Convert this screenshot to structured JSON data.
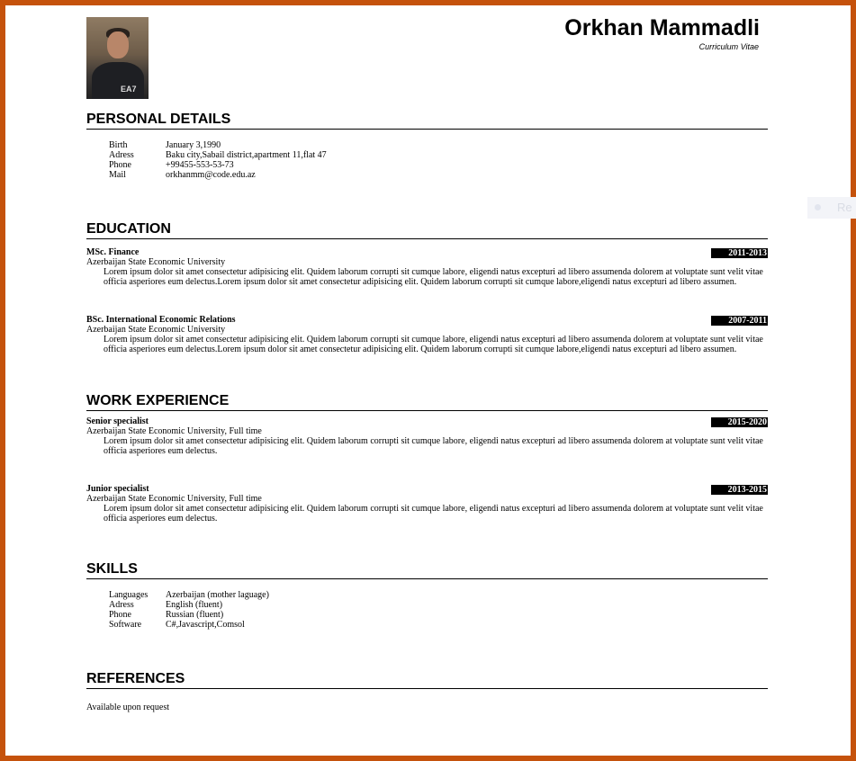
{
  "header": {
    "name": "Orkhan Mammadli",
    "subtitle": "Curriculum Vitae",
    "photo_alt": "profile-photo",
    "photo_logo": "EA7"
  },
  "personal": {
    "title": "PERSONAL DETAILS",
    "rows": [
      {
        "k": "Birth",
        "v": "January 3,1990"
      },
      {
        "k": "Adress",
        "v": "Baku city,Sabail district,apartment 11,flat 47"
      },
      {
        "k": "Phone",
        "v": "+99455-553-53-73"
      },
      {
        "k": "Mail",
        "v": "orkhanmm@code.edu.az"
      }
    ]
  },
  "education": {
    "title": "EDUCATION",
    "entries": [
      {
        "degree": "MSc. Finance",
        "date": "2011-2013",
        "org": "Azerbaijan State Economic University",
        "desc": "Lorem ipsum dolor sit amet consectetur adipisicing elit. Quidem laborum corrupti sit cumque labore, eligendi natus excepturi ad libero assumenda dolorem at voluptate sunt velit vitae officia asperiores eum delectus.Lorem ipsum dolor sit amet consectetur adipisicing elit. Quidem laborum corrupti sit cumque labore,eligendi natus excepturi ad libero assumen."
      },
      {
        "degree": "BSc. International Economic Relations",
        "date": "2007-2011",
        "org": "Azerbaijan State Economic University",
        "desc": "Lorem ipsum dolor sit amet consectetur adipisicing elit. Quidem laborum corrupti sit cumque labore, eligendi natus excepturi ad libero assumenda dolorem at voluptate sunt velit vitae officia asperiores eum delectus.Lorem ipsum dolor sit amet consectetur adipisicing elit. Quidem laborum corrupti sit cumque labore,eligendi natus excepturi ad libero assumen."
      }
    ]
  },
  "work": {
    "title": "WORK EXPERIENCE",
    "entries": [
      {
        "role": "Senior specialist",
        "date": "2015-2020",
        "org": "Azerbaijan State Economic University, Full time",
        "desc": "Lorem ipsum dolor sit amet consectetur adipisicing elit. Quidem laborum corrupti sit cumque labore, eligendi natus excepturi ad libero assumenda dolorem at voluptate sunt velit vitae officia asperiores eum delectus."
      },
      {
        "role": "Junior specialist",
        "date": "2013-2015",
        "org": "Azerbaijan State Economic University, Full time",
        "desc": "Lorem ipsum dolor sit amet consectetur adipisicing elit. Quidem laborum corrupti sit cumque labore, eligendi natus excepturi ad libero assumenda dolorem at voluptate sunt velit vitae officia asperiores eum delectus."
      }
    ]
  },
  "skills": {
    "title": "SKILLS",
    "rows": [
      {
        "k": "Languages",
        "v": "Azerbaijan (mother laguage)"
      },
      {
        "k": "Adress",
        "v": "English (fluent)"
      },
      {
        "k": "Phone",
        "v": "Russian (fluent)"
      },
      {
        "k": "Software",
        "v": "C#,Javascript,Comsol"
      }
    ]
  },
  "references": {
    "title": "REFERENCES",
    "text": "Available upon request"
  },
  "overlay": {
    "text": "Re"
  },
  "colors": {
    "frame": "#c5520c",
    "date_bg": "#000000",
    "date_fg": "#ffffff"
  }
}
